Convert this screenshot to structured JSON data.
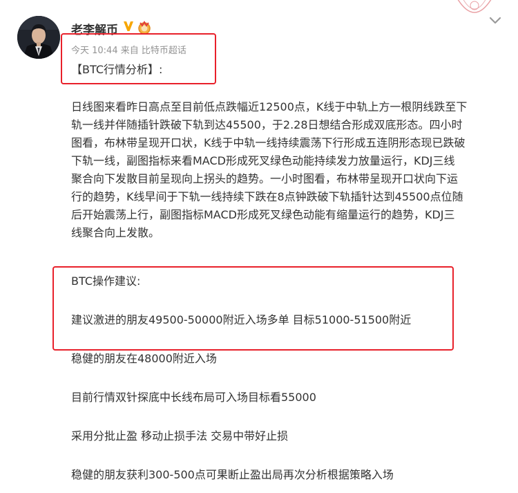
{
  "post": {
    "username": "老李解币",
    "meta": {
      "time": "今天 10:44",
      "source_prefix": "来自",
      "source": "比特币超话"
    },
    "title": "【BTC行情分析】:",
    "analysis_lines": [
      "日线图来看昨日高点至目前低点跌幅近12500点，K线于中轨上方一根阴线跌至下",
      "轨一线并伴随插针跌破下轨到达45500，于2.28日想结合形成双底形态。四小时",
      "图看，布林带呈现开口状，K线于中轨一线持续震荡下行形成五连阴形态现已跌破",
      "下轨一线，副图指标来看MACD形成死叉绿色动能持续发力放量运行，KDJ三线",
      "聚合向下发散目前呈现向上拐头的趋势。一小时图看，布林带呈现开口状向下运",
      "行的趋势，K线早间于下轨一线持续下跌在8点钟跌破下轨插针达到45500点位随",
      "后开始震荡上行，副图指标MACD形成死叉绿色动能有缩量运行的趋势，KDJ三",
      "线聚合向上发散。"
    ],
    "advice_title": "BTC操作建议:",
    "advice_lines": [
      "建议激进的朋友49500-50000附近入场多单    目标51000-51500附近",
      "稳健的朋友在48000附近入场",
      "目前行情双针探底中长线布局可入场目标看55000",
      "采用分批止盈 移动止损手法 交易中带好止损",
      "稳健的朋友获利300-500点可果断止盈出局再次分析根据策略入场"
    ]
  },
  "colors": {
    "highlight_box": "#e8202a",
    "meta_text": "#939393",
    "body_text": "#333333",
    "vip_badge": "#f7a600"
  }
}
